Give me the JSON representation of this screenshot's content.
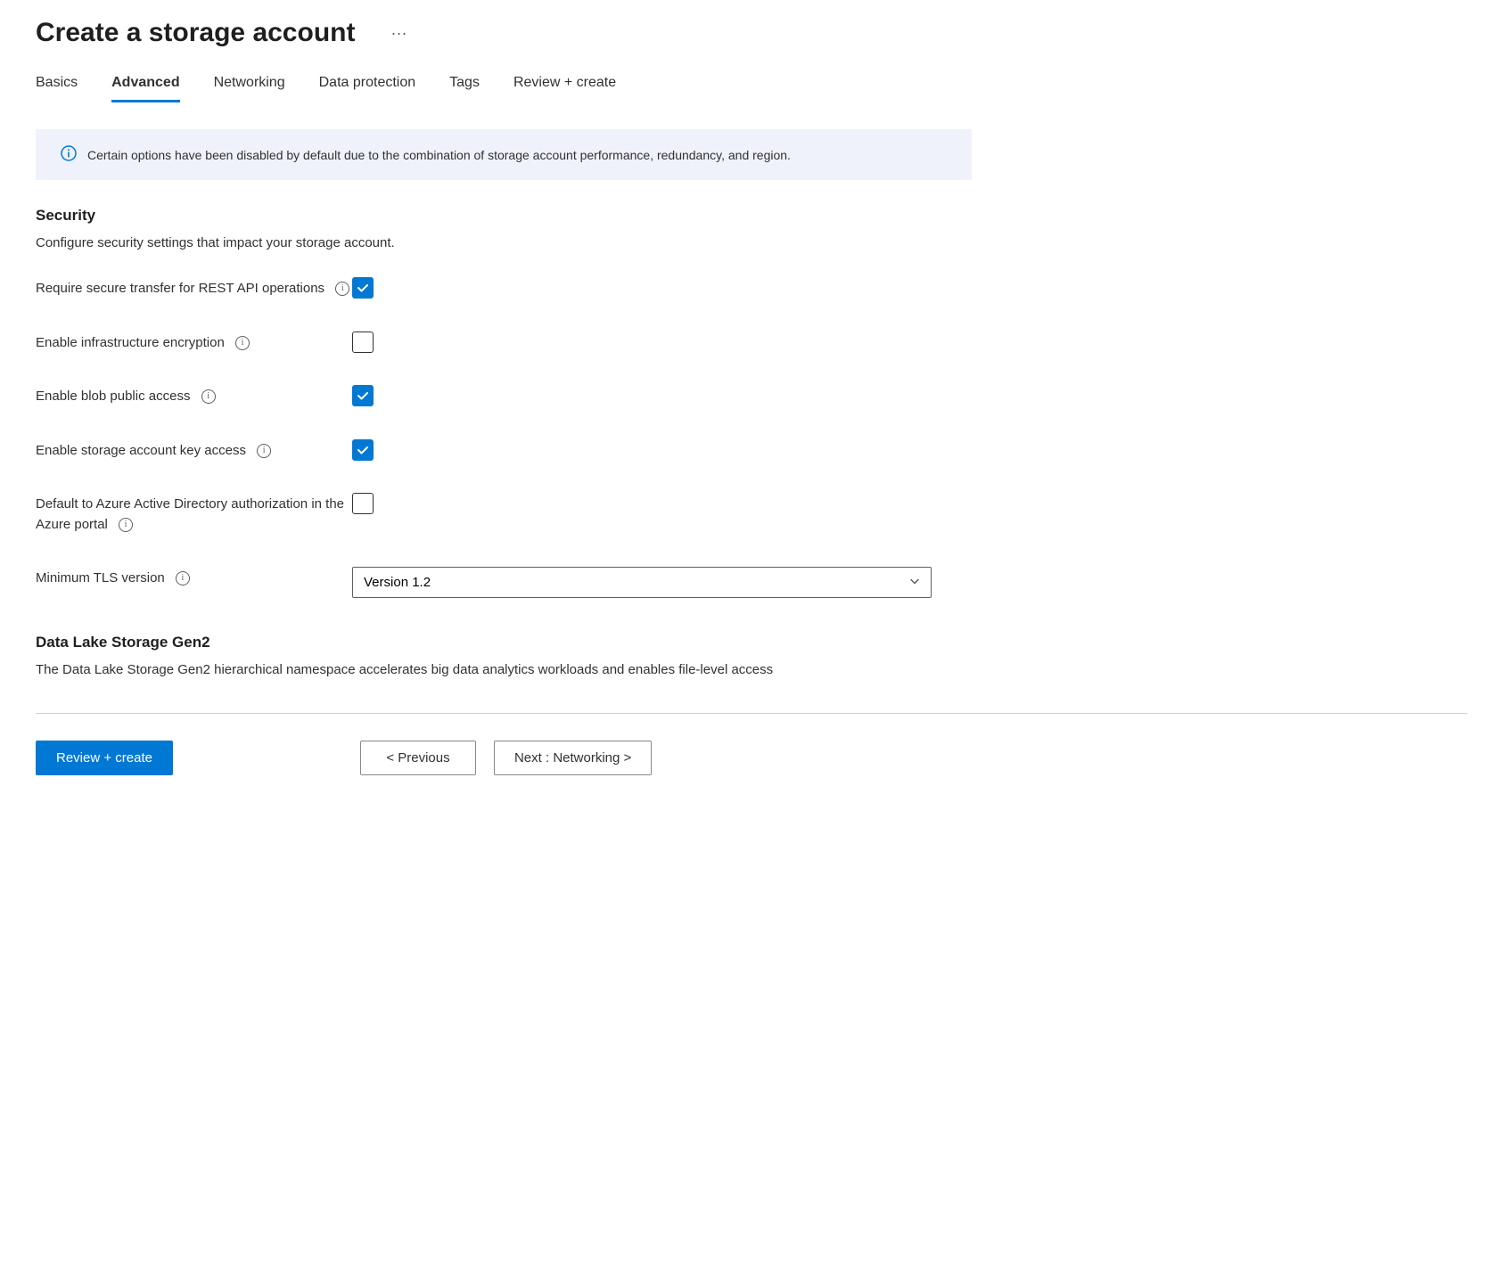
{
  "page": {
    "title": "Create a storage account"
  },
  "tabs": [
    {
      "label": "Basics",
      "active": false
    },
    {
      "label": "Advanced",
      "active": true
    },
    {
      "label": "Networking",
      "active": false
    },
    {
      "label": "Data protection",
      "active": false
    },
    {
      "label": "Tags",
      "active": false
    },
    {
      "label": "Review + create",
      "active": false
    }
  ],
  "banner": {
    "text": "Certain options have been disabled by default due to the combination of storage account performance, redundancy, and region."
  },
  "sections": {
    "security": {
      "title": "Security",
      "desc": "Configure security settings that impact your storage account.",
      "fields": {
        "secure_transfer": {
          "label": "Require secure transfer for REST API operations",
          "checked": true
        },
        "infra_encryption": {
          "label": "Enable infrastructure encryption",
          "checked": false
        },
        "blob_public": {
          "label": "Enable blob public access",
          "checked": true
        },
        "key_access": {
          "label": "Enable storage account key access",
          "checked": true
        },
        "aad_auth": {
          "label": "Default to Azure Active Directory authorization in the Azure portal",
          "checked": false
        },
        "tls": {
          "label": "Minimum TLS version",
          "value": "Version 1.2"
        }
      }
    },
    "datalake": {
      "title": "Data Lake Storage Gen2",
      "desc": "The Data Lake Storage Gen2 hierarchical namespace accelerates big data analytics workloads and enables file-level access"
    }
  },
  "footer": {
    "review": "Review + create",
    "previous": "< Previous",
    "next": "Next : Networking >"
  }
}
